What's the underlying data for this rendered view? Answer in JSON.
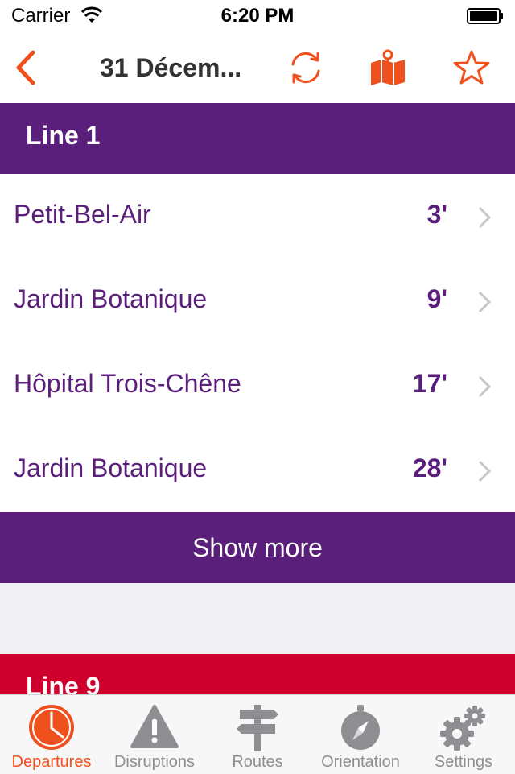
{
  "status_bar": {
    "carrier": "Carrier",
    "time": "6:20 PM"
  },
  "nav": {
    "title": "31 Décem...",
    "back_icon": "chevron-left-icon",
    "actions": [
      "refresh-icon",
      "map-icon",
      "star-icon"
    ],
    "accent_color": "#f0501e"
  },
  "lines": [
    {
      "label": "Line 1",
      "color": "#5a1e7b",
      "departures": [
        {
          "destination": "Petit-Bel-Air",
          "minutes": "3'"
        },
        {
          "destination": "Jardin Botanique",
          "minutes": "9'"
        },
        {
          "destination": "Hôpital Trois-Chêne",
          "minutes": "17'"
        },
        {
          "destination": "Jardin Botanique",
          "minutes": "28'"
        }
      ],
      "show_more": "Show more"
    },
    {
      "label": "Line 9",
      "color": "#d0002e"
    }
  ],
  "tabs": [
    {
      "label": "Departures",
      "icon": "clock-icon",
      "active": true
    },
    {
      "label": "Disruptions",
      "icon": "warning-icon"
    },
    {
      "label": "Routes",
      "icon": "signpost-icon"
    },
    {
      "label": "Orientation",
      "icon": "compass-icon"
    },
    {
      "label": "Settings",
      "icon": "gear-icon"
    }
  ]
}
